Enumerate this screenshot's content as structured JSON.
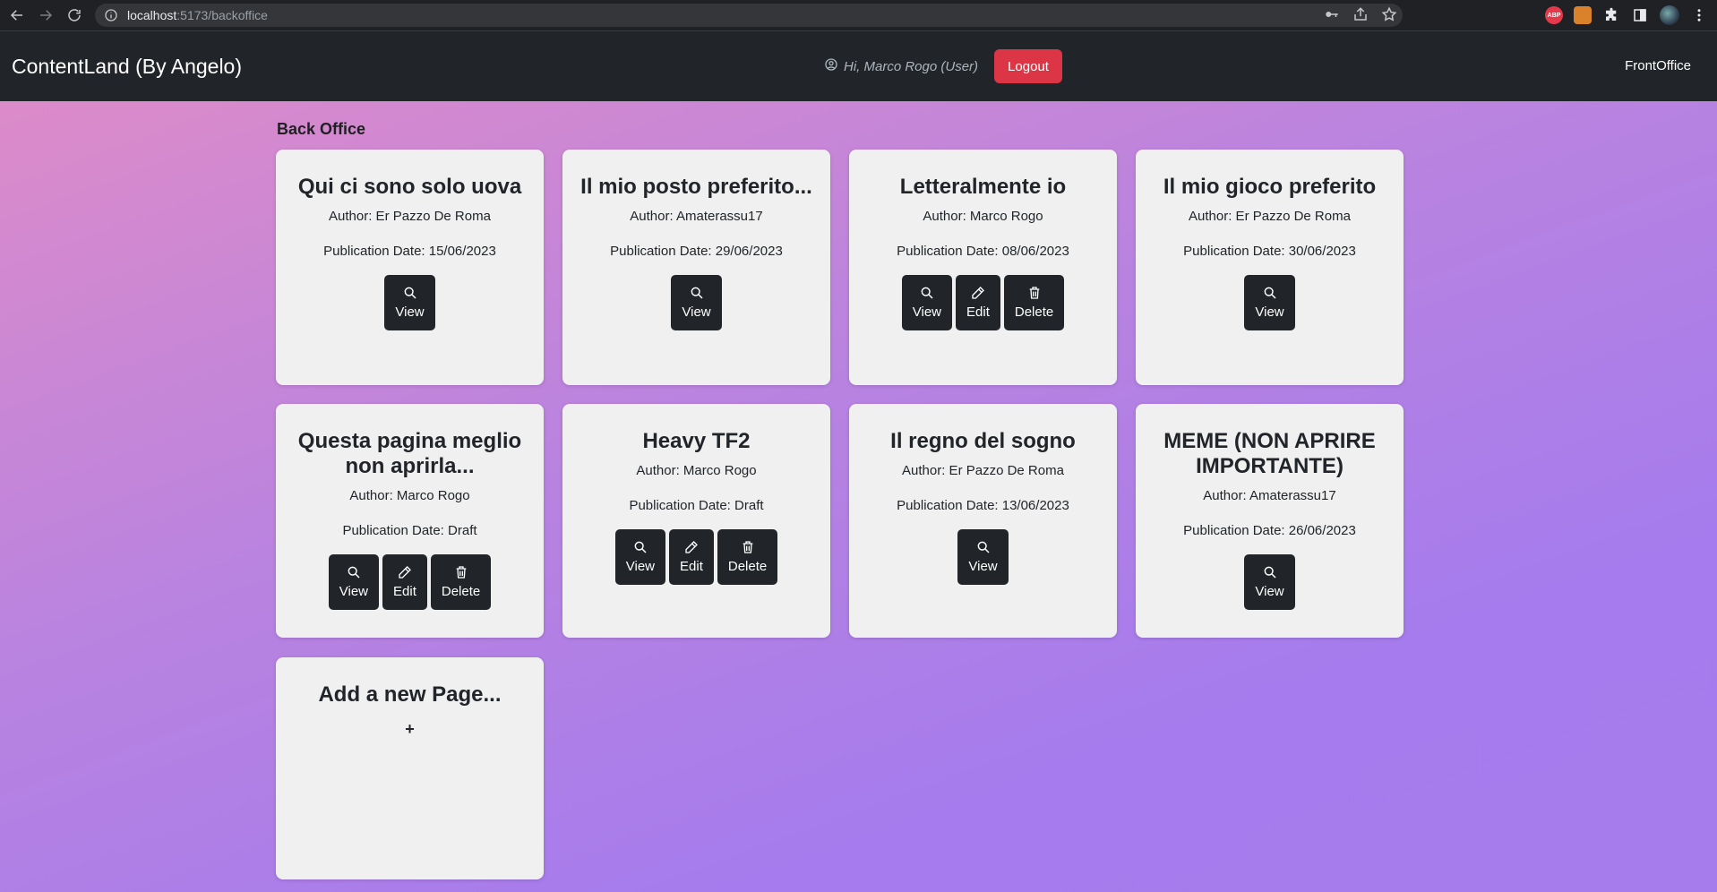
{
  "browser": {
    "url_host": "localhost",
    "url_rest": ":5173/backoffice"
  },
  "navbar": {
    "brand": "ContentLand (By Angelo)",
    "greeting": "Hi, Marco Rogo (User)",
    "logout_label": "Logout",
    "frontoffice_label": "FrontOffice"
  },
  "main": {
    "section_title": "Back Office",
    "cards": [
      {
        "title": "Qui ci sono solo uova",
        "author": "Author: Er Pazzo De Roma",
        "date": "Publication Date: 15/06/2023",
        "view": "View"
      },
      {
        "title": "Il mio posto preferito...",
        "author": "Author: Amaterassu17",
        "date": "Publication Date: 29/06/2023",
        "view": "View"
      },
      {
        "title": "Letteralmente io",
        "author": "Author: Marco Rogo",
        "date": "Publication Date: 08/06/2023",
        "view": "View",
        "edit": "Edit",
        "delete": "Delete"
      },
      {
        "title": "Il mio gioco preferito",
        "author": "Author: Er Pazzo De Roma",
        "date": "Publication Date: 30/06/2023",
        "view": "View"
      },
      {
        "title": "Questa pagina meglio non aprirla...",
        "author": "Author: Marco Rogo",
        "date": "Publication Date: Draft",
        "view": "View",
        "edit": "Edit",
        "delete": "Delete"
      },
      {
        "title": "Heavy TF2",
        "author": "Author: Marco Rogo",
        "date": "Publication Date: Draft",
        "view": "View",
        "edit": "Edit",
        "delete": "Delete"
      },
      {
        "title": "Il regno del sogno",
        "author": "Author: Er Pazzo De Roma",
        "date": "Publication Date: 13/06/2023",
        "view": "View"
      },
      {
        "title": "MEME (NON APRIRE IMPORTANTE)",
        "author": "Author: Amaterassu17",
        "date": "Publication Date: 26/06/2023",
        "view": "View"
      }
    ],
    "add_card": {
      "title": "Add a new Page...",
      "plus": "+"
    }
  }
}
